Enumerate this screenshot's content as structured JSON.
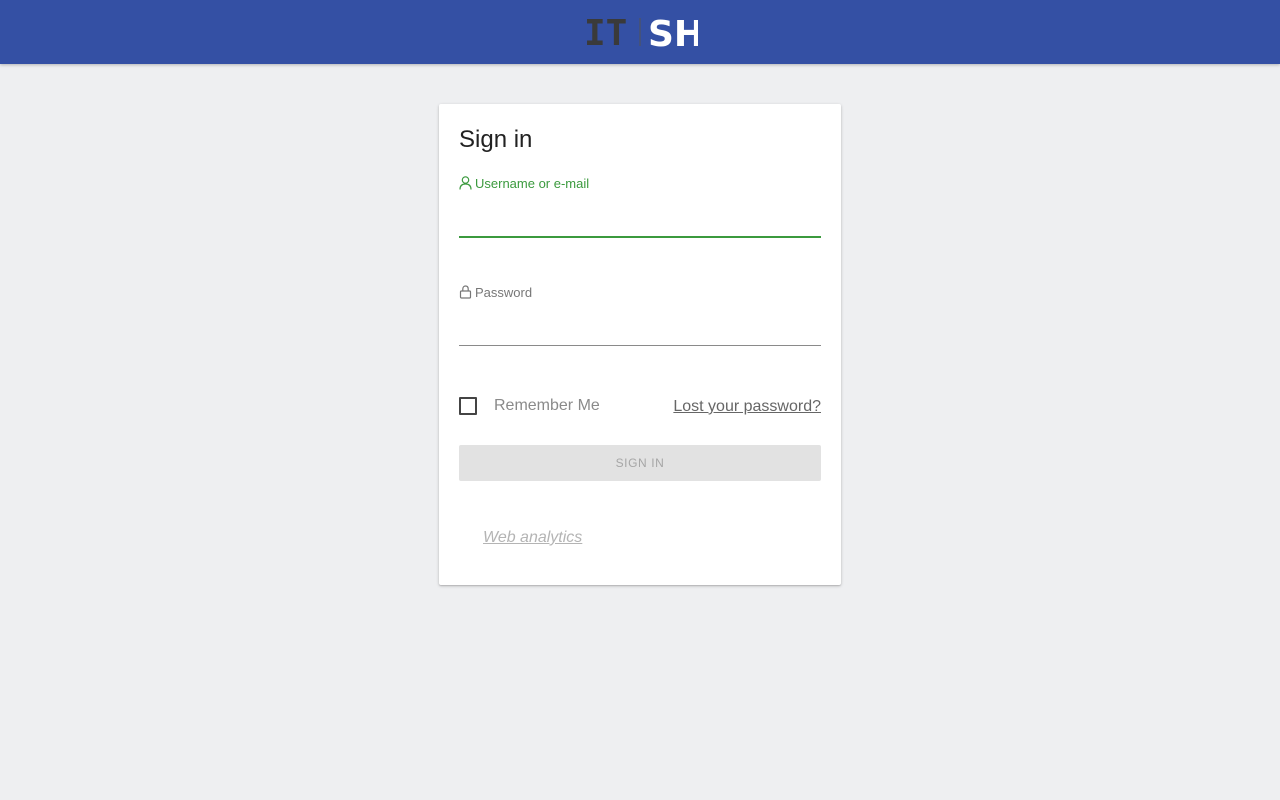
{
  "header": {
    "logo": {
      "left": "IT",
      "right": "SH"
    },
    "colors": {
      "bar": "#3450a4",
      "logo_left": "#3a3a3a",
      "logo_right": "#ffffff"
    }
  },
  "signin": {
    "title": "Sign in",
    "username": {
      "label": "Username or e-mail",
      "value": "",
      "icon": "user-icon"
    },
    "password": {
      "label": "Password",
      "value": "",
      "icon": "lock-icon"
    },
    "remember_me": {
      "label": "Remember Me",
      "checked": false
    },
    "lost_password": "Lost your password?",
    "submit": "SIGN IN",
    "web_analytics": "Web analytics"
  },
  "colors": {
    "focus_green": "#3b9a3e",
    "background": "#eeeff1",
    "button_disabled": "#e2e2e2"
  }
}
